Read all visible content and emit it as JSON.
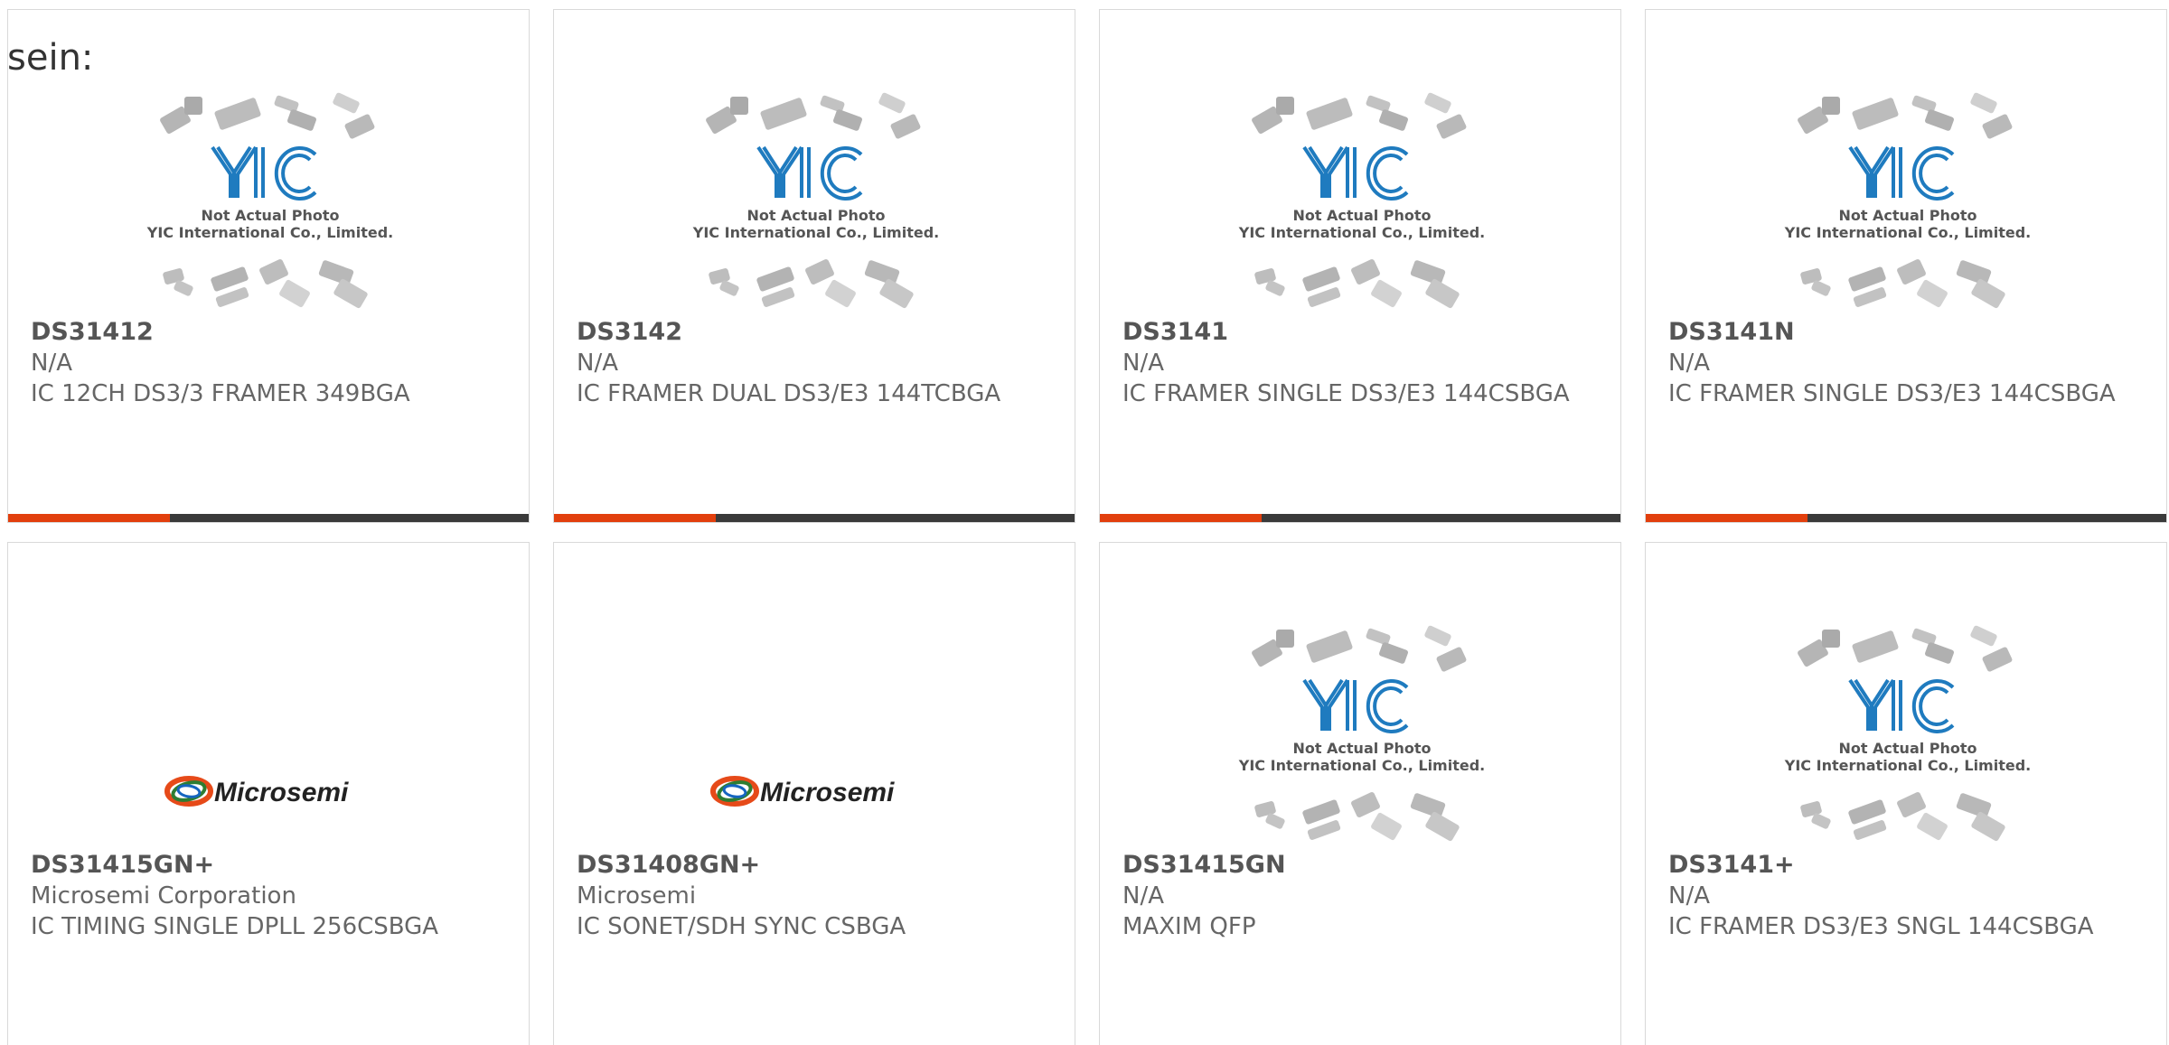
{
  "section_label": "sein:",
  "placeholder_image": {
    "logo": "YIC",
    "line1": "Not Actual Photo",
    "line2": "YIC International Co., Limited."
  },
  "microsemi_logo": "Microsemi",
  "progress_fraction": 0.31,
  "colors": {
    "accent": "#e23f0d",
    "bar": "#3a3a3a",
    "text": "#666666",
    "border": "#d9d9d9",
    "yic_blue": "#1f7bbf"
  },
  "products": [
    {
      "part": "DS31412",
      "manufacturer": "N/A",
      "description": "IC 12CH DS3/3 FRAMER 349BGA",
      "image": "yic-placeholder"
    },
    {
      "part": "DS3142",
      "manufacturer": "N/A",
      "description": "IC FRAMER DUAL DS3/E3 144TCBGA",
      "image": "yic-placeholder"
    },
    {
      "part": "DS3141",
      "manufacturer": "N/A",
      "description": "IC FRAMER SINGLE DS3/E3 144CSBGA",
      "image": "yic-placeholder"
    },
    {
      "part": "DS3141N",
      "manufacturer": "N/A",
      "description": "IC FRAMER SINGLE DS3/E3 144CSBGA",
      "image": "yic-placeholder"
    },
    {
      "part": "DS31415GN+",
      "manufacturer": "Microsemi Corporation",
      "description": "IC TIMING SINGLE DPLL 256CSBGA",
      "image": "microsemi-logo"
    },
    {
      "part": "DS31408GN+",
      "manufacturer": "Microsemi",
      "description": "IC SONET/SDH SYNC CSBGA",
      "image": "microsemi-logo"
    },
    {
      "part": "DS31415GN",
      "manufacturer": "N/A",
      "description": "MAXIM QFP",
      "image": "yic-placeholder"
    },
    {
      "part": "DS3141+",
      "manufacturer": "N/A",
      "description": "IC FRAMER DS3/E3 SNGL 144CSBGA",
      "image": "yic-placeholder"
    }
  ]
}
